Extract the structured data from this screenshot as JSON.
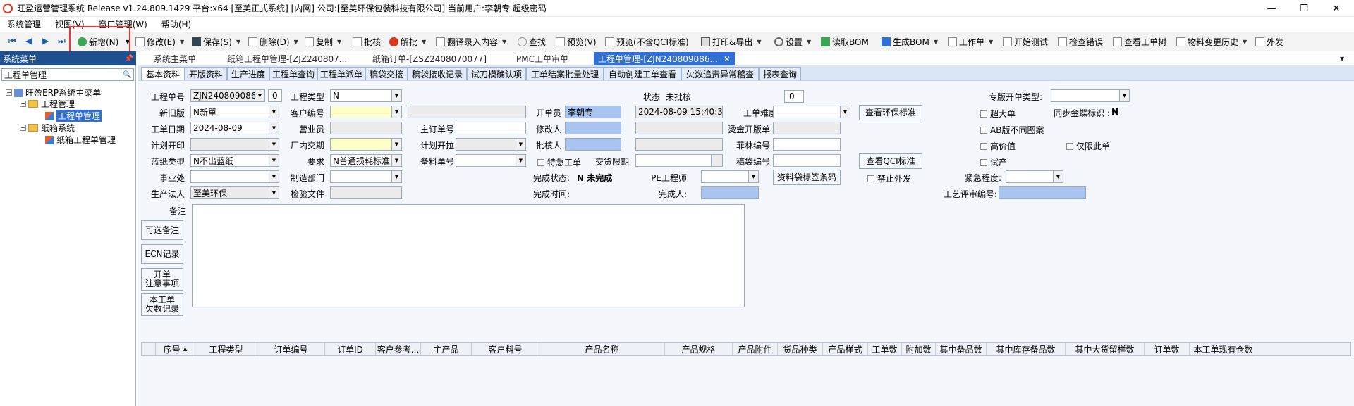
{
  "window": {
    "title": "旺盈运营管理系统 Release v1.24.809.1429 平台:x64  [至美正式系统] [内网] 公司:[至美环保包装科技有限公司] 当前用户:李朝专  超级密码",
    "min": "—",
    "max": "❐",
    "close": "✕"
  },
  "menu": [
    "系统管理",
    "视图(V)",
    "窗口管理(W)",
    "帮助(H)"
  ],
  "toolbar": {
    "nav": [
      "⏮",
      "◀",
      "▶",
      "⏭"
    ],
    "add": "新增(N)",
    "edit": "修改(E)",
    "save": "保存(S)",
    "delete": "删除(D)",
    "copy": "复制",
    "approve": "批核",
    "unapprove": "解批",
    "translate": "翻译录入内容",
    "search": "查找",
    "preview": "预览(V)",
    "preview_noqci": "预览(不含QCI标准)",
    "print": "打印&导出",
    "settings": "设置",
    "read_bom": "读取BOM",
    "gen_bom": "生成BOM",
    "workorder": "工作单",
    "start_test": "开始测试",
    "check_err": "检查错误",
    "view_tree": "查看工单树",
    "material_hist": "物料变更历史",
    "outsource": "外发"
  },
  "side": {
    "header": "系统菜单",
    "pin": "📌",
    "search_value": "工程单管理",
    "search_icon": "🔍",
    "root": "旺盈ERP系统主菜单",
    "engineering": "工程管理",
    "workorder_mgmt": "工程单管理",
    "carton": "纸箱系统",
    "carton_mgmt": "纸箱工程单管理"
  },
  "tabs": [
    "系统主菜单",
    "纸箱工程单管理-[ZJZ240807...",
    "纸箱订单-[ZSZ2408070077]",
    "PMC工单审单",
    "工程单管理-[ZJN240809086..."
  ],
  "tab_close": "✕",
  "subtabs": [
    "基本资料",
    "开版资料",
    "生产进度",
    "工程单查询",
    "工程单派单",
    "稿袋交接",
    "稿袋接收记录",
    "试刀模确认项",
    "工单结案批量处理",
    "自动创建工单查看",
    "欠数追责异常稽查",
    "报表查询"
  ],
  "form": {
    "l_order_no": "工程单号",
    "v_order_no": "ZJN240809086",
    "v_order_no_sfx": "0",
    "l_type": "工程类型",
    "v_type": "N",
    "l_status": "状态",
    "v_status": "未批核",
    "v_status_num": "0",
    "l_special_type": "专版开单类型:",
    "l_newold": "新旧版",
    "v_newold": "N新單",
    "l_customer": "客户编号",
    "l_opener": "开单员",
    "v_opener": "李朝专",
    "v_open_time": "2024-08-09 15:40:34",
    "l_difficulty": "工单难度",
    "btn_env": "查看环保标准",
    "c_oversize": "超大单",
    "l_sync": "同步金蝶标识 :",
    "v_sync": "N",
    "l_date": "工单日期",
    "v_date": "2024-08-09",
    "l_sales": "营业员",
    "l_main_order": "主订单号",
    "l_modifier": "修改人",
    "l_hot_stamp": "烫金开版单",
    "c_ab": "AB版不同图案",
    "l_plan_print": "计划开印",
    "l_factory_date": "厂内交期",
    "l_plan_pull": "计划开拉",
    "l_approver": "批核人",
    "l_film": "菲林编号",
    "c_high_value": "高价值",
    "c_only": "仅限此单",
    "l_paper_type": "蓝纸类型",
    "v_paper_type": "N不出蓝纸",
    "l_require": "要求",
    "v_require": "N普通损耗标准",
    "l_material_no": "备料单号",
    "c_special": "特急工单",
    "l_deliver": "交货限期",
    "l_bag_no": "稿袋编号",
    "btn_qci": "查看QCI标准",
    "c_trial": "试产",
    "l_division": "事业处",
    "l_dept": "制造部门",
    "l_done_status": "完成状态:",
    "v_done_status": "N 未完成",
    "l_pe": "PE工程师",
    "btn_label": "资料袋标签条码",
    "c_no_out": "禁止外发",
    "l_urgency": "紧急程度:",
    "l_legal": "生产法人",
    "v_legal": "至美环保",
    "l_inspect": "检验文件",
    "l_done_time": "完成时间:",
    "l_completer": "完成人:",
    "l_review": "工艺评审编号:",
    "l_memo": "备注",
    "b_optional": "可选备注",
    "b_ecn": "ECN记录",
    "b_note1": "开单",
    "b_note2": "注意事项",
    "b_short1": "本工单",
    "b_short2": "欠数记录"
  },
  "grid": {
    "sort_arrow": "▲",
    "cols": [
      "序号",
      "工程类型",
      "订单编号",
      "订单ID",
      "客户参考...",
      "主产品",
      "客户料号",
      "产品名称",
      "产品规格",
      "产品附件",
      "货品种类",
      "产品样式",
      "工单数",
      "附加数",
      "其中备品数",
      "其中库存备品数",
      "其中大货留样数",
      "订单数",
      "本工单现有仓数"
    ]
  },
  "arrow": "▼",
  "colors": {
    "accent": "#2f6fd6",
    "highlight": "#e53935",
    "yellow": "#ffffc8",
    "blue_field": "#a9c4f0"
  }
}
